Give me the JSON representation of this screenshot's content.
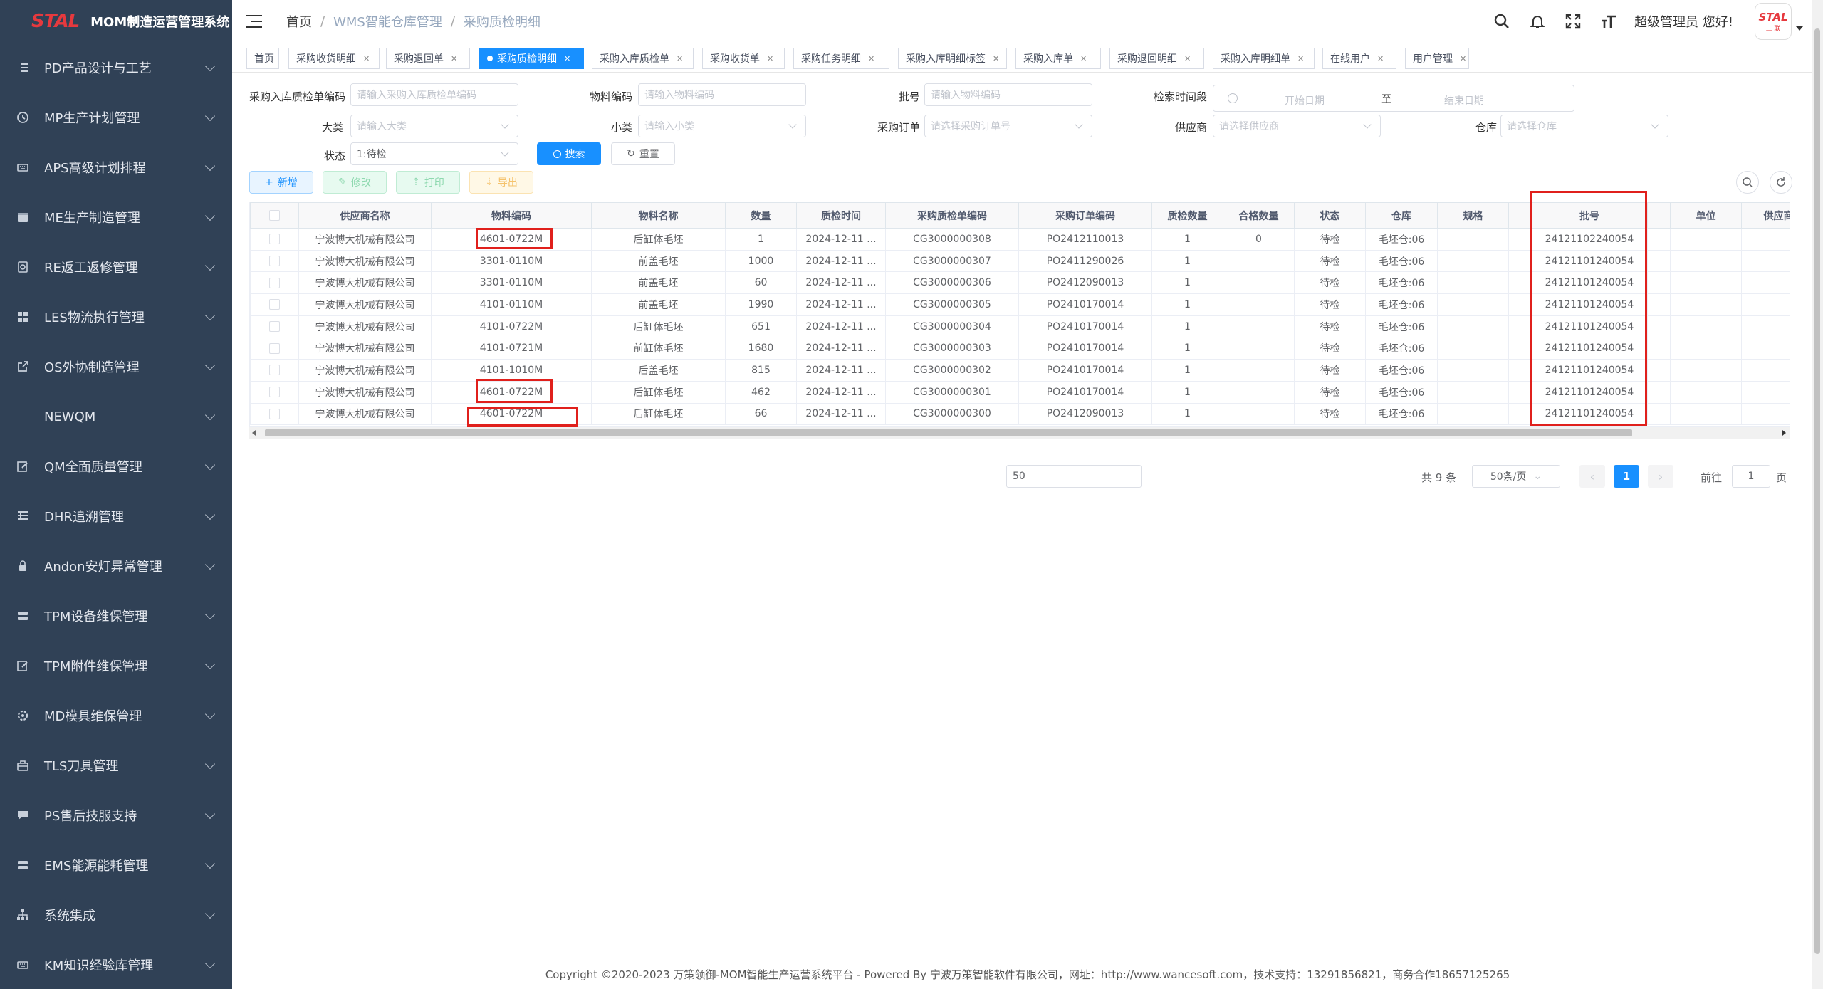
{
  "app": {
    "logo_mark": "STAL",
    "title": "MOM制造运营管理系统"
  },
  "sidebar": {
    "items": [
      {
        "label": "PD产品设计与工艺",
        "icon": "list-icon"
      },
      {
        "label": "MP生产计划管理",
        "icon": "clock-icon"
      },
      {
        "label": "APS高级计划排程",
        "icon": "keyboard-icon"
      },
      {
        "label": "ME生产制造管理",
        "icon": "calendar-icon"
      },
      {
        "label": "RE返工返修管理",
        "icon": "rework-icon"
      },
      {
        "label": "LES物流执行管理",
        "icon": "grid-icon"
      },
      {
        "label": "OS外协制造管理",
        "icon": "external-link-icon"
      },
      {
        "label": "NEWQM",
        "icon": ""
      },
      {
        "label": "QM全面质量管理",
        "icon": "edit-icon"
      },
      {
        "label": "DHR追溯管理",
        "icon": "tree-table-icon"
      },
      {
        "label": "Andon安灯异常管理",
        "icon": "lock-icon"
      },
      {
        "label": "TPM设备维保管理",
        "icon": "server-icon"
      },
      {
        "label": "TPM附件维保管理",
        "icon": "edit-icon"
      },
      {
        "label": "MD模具维保管理",
        "icon": "gear-icon"
      },
      {
        "label": "TLS刀具管理",
        "icon": "toolbox-icon"
      },
      {
        "label": "PS售后技服支持",
        "icon": "chat-icon"
      },
      {
        "label": "EMS能源能耗管理",
        "icon": "server-icon"
      },
      {
        "label": "系统集成",
        "icon": "sitemap-icon"
      },
      {
        "label": "KM知识经验库管理",
        "icon": "keyboard-icon"
      }
    ]
  },
  "header": {
    "breadcrumb": [
      "首页",
      "WMS智能仓库管理",
      "采购质检明细"
    ],
    "welcome": "超级管理员 您好!",
    "avatar_text": "STAL",
    "avatar_sub": "三 联"
  },
  "tags": [
    {
      "label": "首页",
      "closable": false,
      "active": false
    },
    {
      "label": "采购收货明细",
      "closable": true,
      "active": false
    },
    {
      "label": "采购退回单",
      "closable": true,
      "active": false
    },
    {
      "label": "采购质检明细",
      "closable": true,
      "active": true
    },
    {
      "label": "采购入库质检单",
      "closable": true,
      "active": false
    },
    {
      "label": "采购收货单",
      "closable": true,
      "active": false
    },
    {
      "label": "采购任务明细",
      "closable": true,
      "active": false
    },
    {
      "label": "采购入库明细标签",
      "closable": true,
      "active": false
    },
    {
      "label": "采购入库单",
      "closable": true,
      "active": false
    },
    {
      "label": "采购退回明细",
      "closable": true,
      "active": false
    },
    {
      "label": "采购入库明细单",
      "closable": true,
      "active": false
    },
    {
      "label": "在线用户",
      "closable": true,
      "active": false
    },
    {
      "label": "用户管理",
      "closable": true,
      "active": false
    }
  ],
  "filters": {
    "inspect_code": {
      "label": "采购入库质检单编码",
      "placeholder": "请输入采购入库质检单编码"
    },
    "material_code": {
      "label": "物料编码",
      "placeholder": "请输入物料编码"
    },
    "batch": {
      "label": "批号",
      "placeholder": "请输入物料编码"
    },
    "time_range": {
      "label": "检索时间段",
      "start": "开始日期",
      "sep": "至",
      "end": "结束日期"
    },
    "category": {
      "label": "大类",
      "placeholder": "请输入大类"
    },
    "subcategory": {
      "label": "小类",
      "placeholder": "请输入小类"
    },
    "purchase_order": {
      "label": "采购订单",
      "placeholder": "请选择采购订单号"
    },
    "supplier": {
      "label": "供应商",
      "placeholder": "请选择供应商"
    },
    "warehouse": {
      "label": "仓库",
      "placeholder": "请选择仓库"
    },
    "status": {
      "label": "状态",
      "value": "1:待检"
    },
    "search_label": "搜索",
    "reset_label": "重置"
  },
  "toolbar": {
    "add": "新增",
    "edit": "修改",
    "print": "打印",
    "export": "导出"
  },
  "table": {
    "columns": [
      "供应商名称",
      "物料编码",
      "物料名称",
      "数量",
      "质检时间",
      "采购质检单编码",
      "采购订单编码",
      "质检数量",
      "合格数量",
      "状态",
      "仓库",
      "规格",
      "",
      "批号",
      "",
      "单位",
      "供应商..."
    ],
    "rows": [
      [
        "宁波博大机械有限公司",
        "4601-0722M",
        "后缸体毛坯",
        "1",
        "2024-12-11 ...",
        "CG3000000308",
        "PO2412110013",
        "1",
        "0",
        "待检",
        "毛坯仓:06",
        "",
        "",
        "24121102240054",
        "",
        "",
        ""
      ],
      [
        "宁波博大机械有限公司",
        "3301-0110M",
        "前盖毛坯",
        "1000",
        "2024-12-11 ...",
        "CG3000000307",
        "PO2411290026",
        "1",
        "",
        "待检",
        "毛坯仓:06",
        "",
        "",
        "24121101240054",
        "",
        "",
        ""
      ],
      [
        "宁波博大机械有限公司",
        "3301-0110M",
        "前盖毛坯",
        "60",
        "2024-12-11 ...",
        "CG3000000306",
        "PO2412090013",
        "1",
        "",
        "待检",
        "毛坯仓:06",
        "",
        "",
        "24121101240054",
        "",
        "",
        ""
      ],
      [
        "宁波博大机械有限公司",
        "4101-0110M",
        "前盖毛坯",
        "1990",
        "2024-12-11 ...",
        "CG3000000305",
        "PO2410170014",
        "1",
        "",
        "待检",
        "毛坯仓:06",
        "",
        "",
        "24121101240054",
        "",
        "",
        ""
      ],
      [
        "宁波博大机械有限公司",
        "4101-0722M",
        "后缸体毛坯",
        "651",
        "2024-12-11 ...",
        "CG3000000304",
        "PO2410170014",
        "1",
        "",
        "待检",
        "毛坯仓:06",
        "",
        "",
        "24121101240054",
        "",
        "",
        ""
      ],
      [
        "宁波博大机械有限公司",
        "4101-0721M",
        "前缸体毛坯",
        "1680",
        "2024-12-11 ...",
        "CG3000000303",
        "PO2410170014",
        "1",
        "",
        "待检",
        "毛坯仓:06",
        "",
        "",
        "24121101240054",
        "",
        "",
        ""
      ],
      [
        "宁波博大机械有限公司",
        "4101-1010M",
        "后盖毛坯",
        "815",
        "2024-12-11 ...",
        "CG3000000302",
        "PO2410170014",
        "1",
        "",
        "待检",
        "毛坯仓:06",
        "",
        "",
        "24121101240054",
        "",
        "",
        ""
      ],
      [
        "宁波博大机械有限公司",
        "4601-0722M",
        "后缸体毛坯",
        "462",
        "2024-12-11 ...",
        "CG3000000301",
        "PO2410170014",
        "1",
        "",
        "待检",
        "毛坯仓:06",
        "",
        "",
        "24121101240054",
        "",
        "",
        ""
      ],
      [
        "宁波博大机械有限公司",
        "4601-0722M",
        "后缸体毛坯",
        "66",
        "2024-12-11 ...",
        "CG3000000300",
        "PO2412090013",
        "1",
        "",
        "待检",
        "毛坯仓:06",
        "",
        "",
        "24121101240054",
        "",
        "",
        ""
      ]
    ]
  },
  "pagination": {
    "jump_value": "50",
    "total": "共 9 条",
    "page_size": "50条/页",
    "current": "1",
    "goto_label": "前往",
    "goto_value": "1",
    "page_unit": "页"
  },
  "footer": {
    "text": "Copyright ©2020-2023 万策领御-MOM智能生产运营系统平台 - Powered By 宁波万策智能软件有限公司，网址：http://www.wancesoft.com，技术支持：13291856821，商务合作18657125265"
  }
}
